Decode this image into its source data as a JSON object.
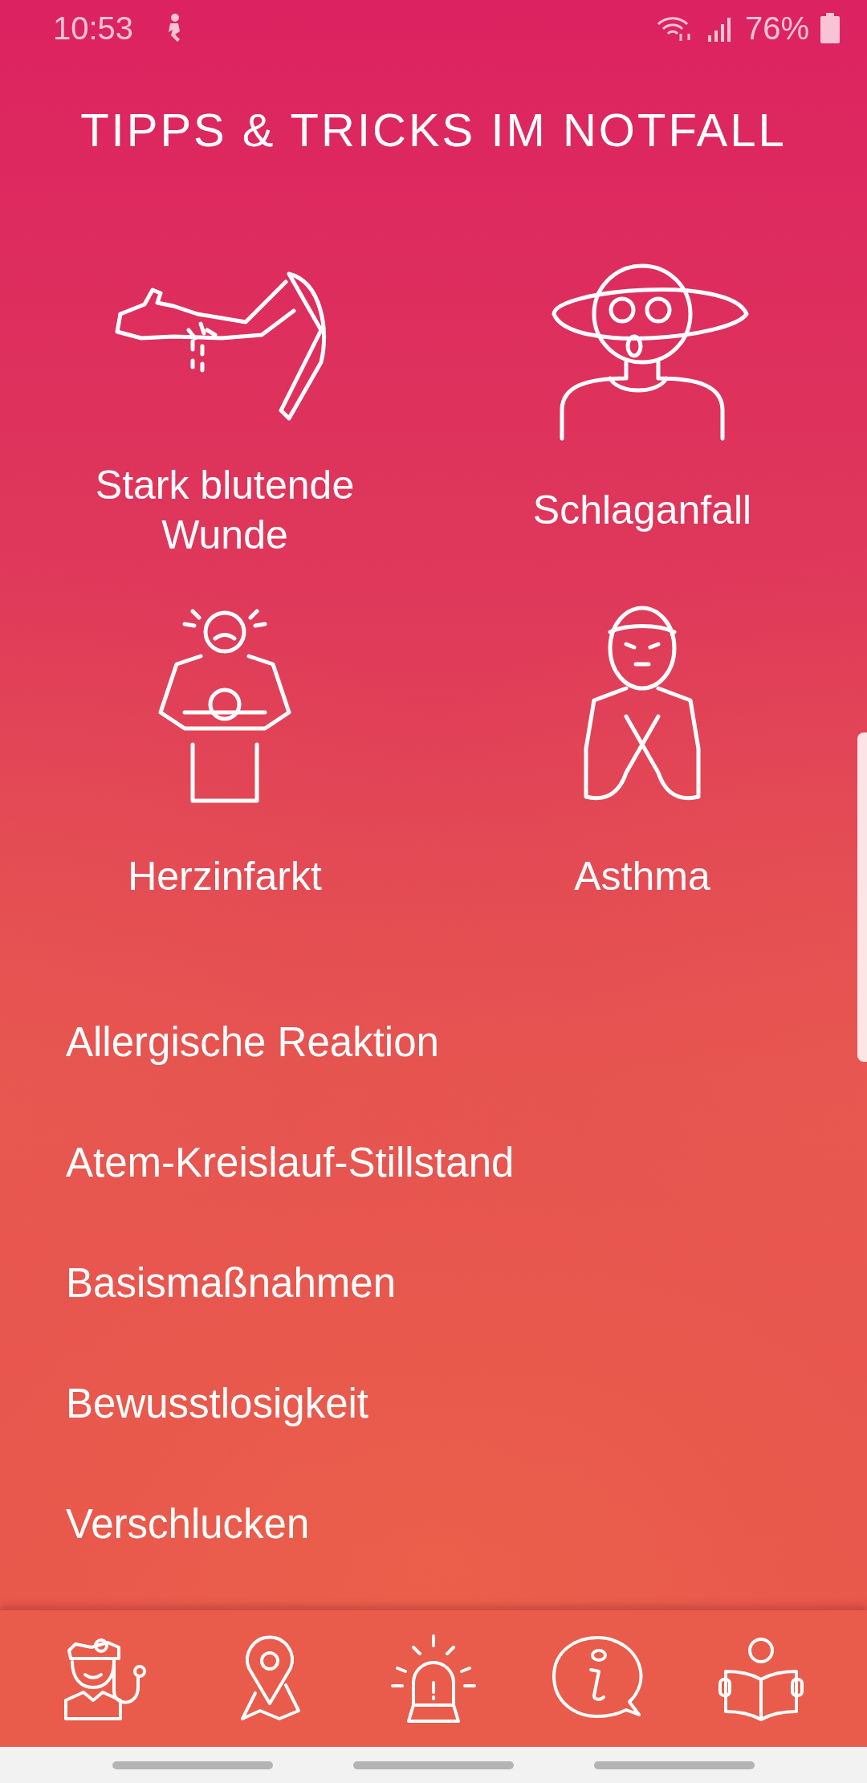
{
  "status_bar": {
    "time": "10:53",
    "battery": "76%"
  },
  "title": "TIPPS & TRICKS IM NOTFALL",
  "tiles": [
    {
      "kind": "wound",
      "label": "Stark blutende Wunde"
    },
    {
      "kind": "stroke",
      "label": "Schlaganfall"
    },
    {
      "kind": "heart",
      "label": "Herzinfarkt"
    },
    {
      "kind": "asthma",
      "label": "Asthma"
    }
  ],
  "topics": [
    "Allergische Reaktion",
    "Atem-Kreislauf-Stillstand",
    "Basismaßnahmen",
    "Bewusstlosigkeit",
    "Verschlucken"
  ],
  "nav": [
    {
      "kind": "doctor"
    },
    {
      "kind": "map"
    },
    {
      "kind": "alarm"
    },
    {
      "kind": "info"
    },
    {
      "kind": "reader"
    }
  ]
}
